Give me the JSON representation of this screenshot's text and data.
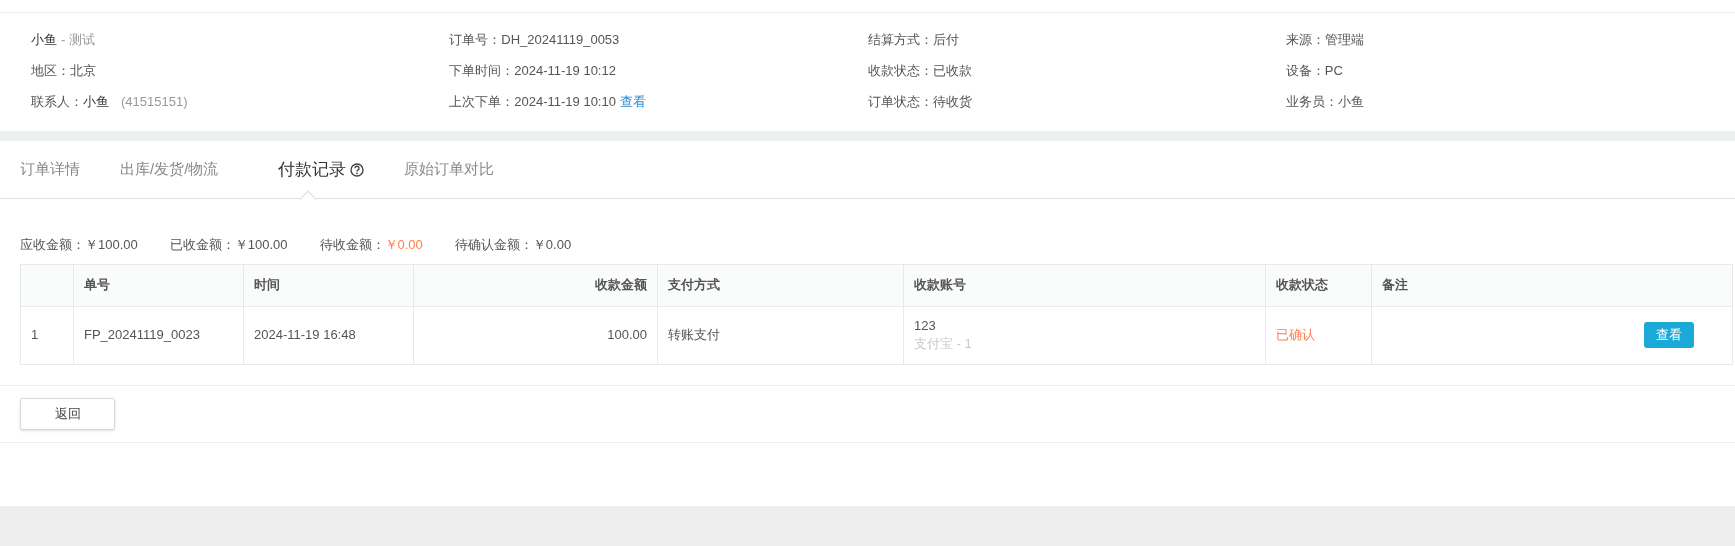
{
  "info_columns": [
    [
      {
        "kind": "name",
        "value": "小鱼",
        "suffix": "- 测试"
      },
      {
        "kind": "field",
        "label": "地区：",
        "value": "北京"
      },
      {
        "kind": "contact",
        "label": "联系人：",
        "value": "小鱼",
        "note": "(41515151)"
      }
    ],
    [
      {
        "kind": "field",
        "label": "订单号：",
        "value": "DH_20241119_0053"
      },
      {
        "kind": "field",
        "label": "下单时间：",
        "value": "2024-11-19 10:12"
      },
      {
        "kind": "link",
        "label": "上次下单：",
        "value": "2024-11-19 10:10",
        "link": "查看"
      }
    ],
    [
      {
        "kind": "field",
        "label": "结算方式：",
        "value": "后付"
      },
      {
        "kind": "field",
        "label": "收款状态：",
        "value": "已收款"
      },
      {
        "kind": "field",
        "label": "订单状态：",
        "value": "待收货"
      }
    ],
    [
      {
        "kind": "field",
        "label": "来源：",
        "value": "管理端"
      },
      {
        "kind": "field",
        "label": "设备：",
        "value": "PC"
      },
      {
        "kind": "field",
        "label": "业务员：",
        "value": "小鱼"
      }
    ]
  ],
  "tabs": [
    {
      "label": "订单详情",
      "selected": false
    },
    {
      "label": "出库/发货/物流",
      "selected": false
    },
    {
      "label": "付款记录",
      "selected": true,
      "help": true
    },
    {
      "label": "原始订单对比",
      "selected": false
    }
  ],
  "summary": [
    {
      "label": "应收金额：",
      "value": "￥100.00",
      "highlight": false
    },
    {
      "label": "已收金额：",
      "value": "￥100.00",
      "highlight": false
    },
    {
      "label": "待收金额：",
      "value": "￥0.00",
      "highlight": true
    },
    {
      "label": "待确认金额：",
      "value": "￥0.00",
      "highlight": false
    }
  ],
  "table": {
    "columns": [
      "单号",
      "时间",
      "收款金额",
      "支付方式",
      "收款账号",
      "收款状态",
      "备注"
    ],
    "rows": [
      {
        "index": "1",
        "number": "FP_20241119_0023",
        "time": "2024-11-19 16:48",
        "amount": "100.00",
        "method": "转账支付",
        "account": "123",
        "account_sub": "支付宝 - 1",
        "status": "已确认",
        "action": "查看"
      }
    ]
  },
  "back_button": "返回"
}
